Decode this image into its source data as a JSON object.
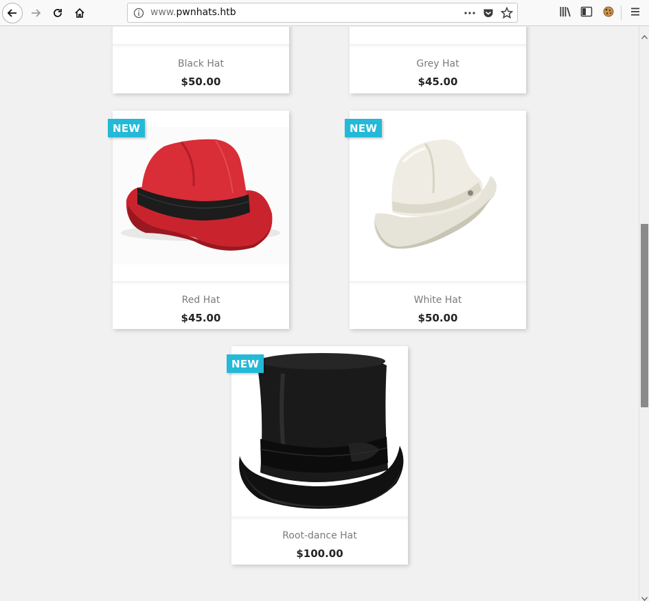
{
  "browser": {
    "url_prefix": "www.",
    "url_domain": "pwnhats.htb",
    "icons": [
      "back-icon",
      "forward-icon",
      "reload-icon",
      "home-icon",
      "info-icon",
      "more-icon",
      "pocket-icon",
      "star-icon",
      "library-icon",
      "sidebar-icon",
      "cookie-icon",
      "menu-icon"
    ]
  },
  "products": [
    {
      "name": "Black Hat",
      "price": "$50.00",
      "new": false
    },
    {
      "name": "Grey Hat",
      "price": "$45.00",
      "new": false
    },
    {
      "name": "Red Hat",
      "price": "$45.00",
      "new": true
    },
    {
      "name": "White Hat",
      "price": "$50.00",
      "new": true
    },
    {
      "name": "Root-dance Hat",
      "price": "$100.00",
      "new": true
    }
  ],
  "badge_label": "NEW",
  "colors": {
    "badge": "#24b9d7",
    "page_bg": "#f1f1f1",
    "price": "#232323",
    "name": "#7a7a7a"
  }
}
